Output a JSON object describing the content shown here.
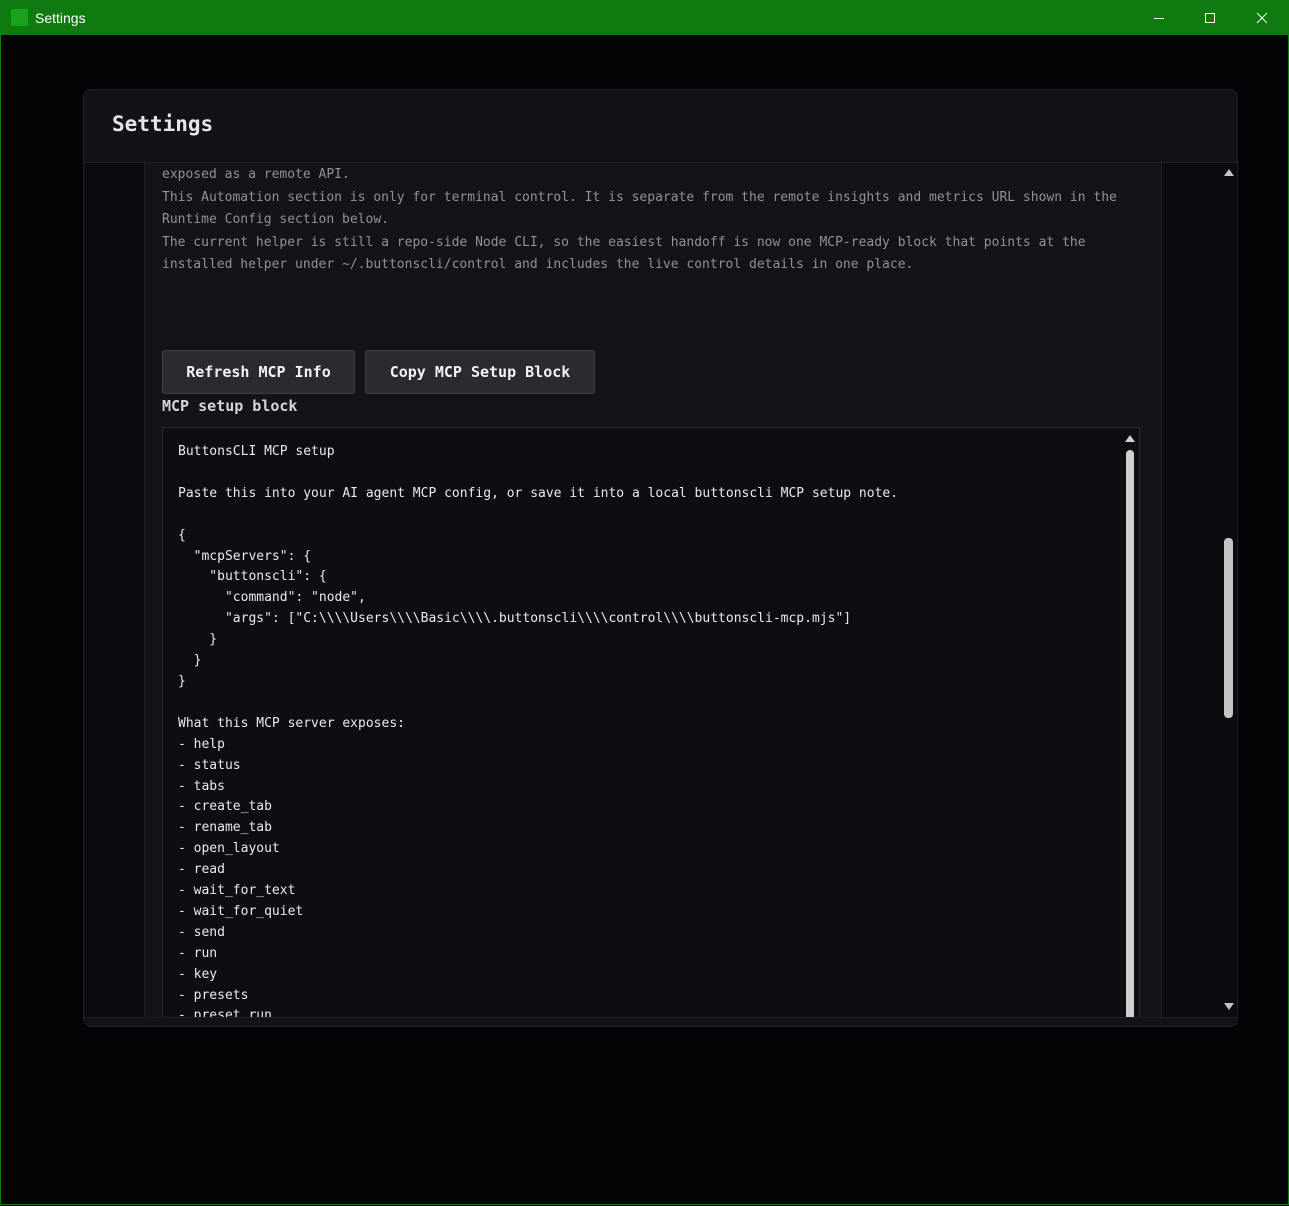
{
  "window": {
    "title": "Settings",
    "controls": [
      "minimize-icon",
      "maximize-icon",
      "close-icon"
    ]
  },
  "dialog": {
    "title": "Settings"
  },
  "automation": {
    "paragraphs": [
      "exposed as a remote API.",
      "This Automation section is only for terminal control. It is separate from the remote insights and metrics URL shown in the",
      "Runtime Config section below.",
      "The current helper is still a repo-side Node CLI, so the easiest handoff is now one MCP-ready block that points at the",
      "installed helper under ~/.buttonscli/control and includes the live control details in one place."
    ],
    "refresh_label": "Refresh MCP Info",
    "copy_label": "Copy MCP Setup Block",
    "block_label": "MCP setup block",
    "block_text": "ButtonsCLI MCP setup\n\nPaste this into your AI agent MCP config, or save it into a local buttonscli MCP setup note.\n\n{\n  \"mcpServers\": {\n    \"buttonscli\": {\n      \"command\": \"node\",\n      \"args\": [\"C:\\\\\\\\Users\\\\\\\\Basic\\\\\\\\.buttonscli\\\\\\\\control\\\\\\\\buttonscli-mcp.mjs\"]\n    }\n  }\n}\n\nWhat this MCP server exposes:\n- help\n- status\n- tabs\n- create_tab\n- rename_tab\n- open_layout\n- read\n- wait_for_text\n- wait_for_quiet\n- send\n- run\n- key\n- presets\n- preset_run\n\nRuntime details:\n- MCP helper: C:\\Users\\Basic\\.buttonscli\\control\\buttonscli-mcp.mjs"
  },
  "colors": {
    "titlebar": "#0f7a0f",
    "background": "#040406",
    "panel": "#131419"
  }
}
